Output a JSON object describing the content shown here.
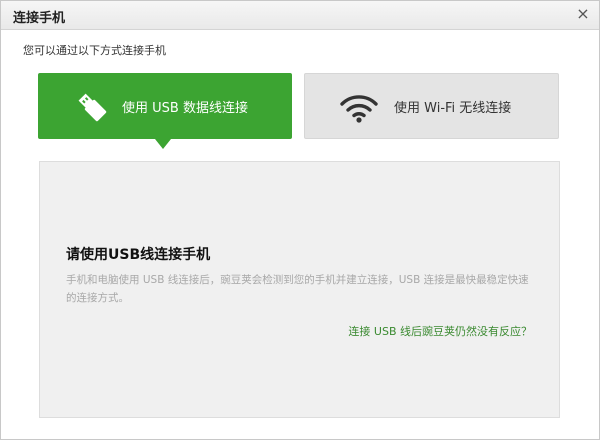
{
  "window": {
    "title": "连接手机",
    "close_symbol": "×"
  },
  "subtitle": "您可以通过以下方式连接手机",
  "options": {
    "usb": {
      "label": "使用 USB 数据线连接",
      "icon": "usb-plug-icon",
      "selected": true
    },
    "wifi": {
      "label": "使用 Wi-Fi 无线连接",
      "icon": "wifi-icon",
      "selected": false
    }
  },
  "panel": {
    "heading": "请使用USB线连接手机",
    "description": "手机和电脑使用 USB 线连接后，豌豆荚会检测到您的手机并建立连接，USB 连接是最快最稳定快速的连接方式。",
    "help_link": "连接 USB 线后豌豆荚仍然没有反应？"
  },
  "colors": {
    "accent_green": "#3ca432",
    "inactive_option": "#e4e4e4",
    "panel_background": "#f0f0f0",
    "link_green": "#3a8a30",
    "muted_text": "#a8a8a8"
  }
}
